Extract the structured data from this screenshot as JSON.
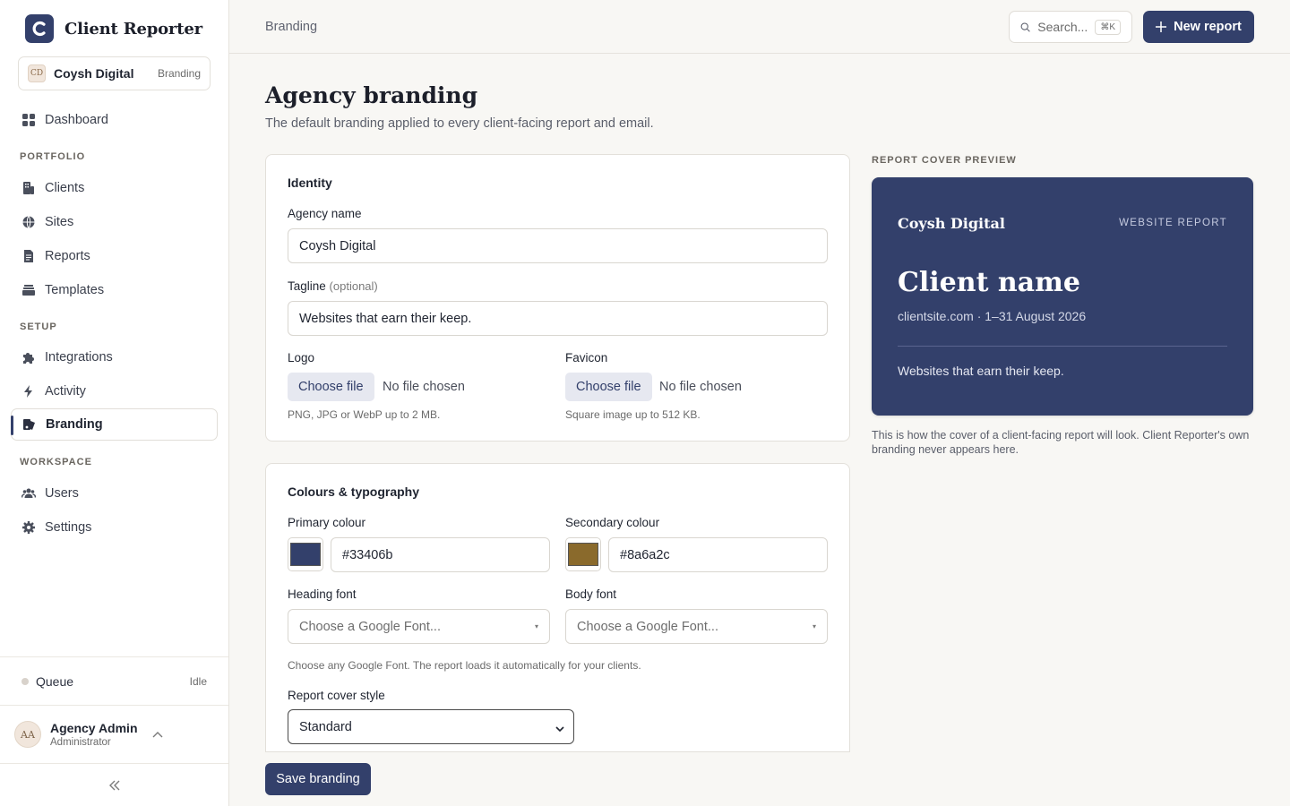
{
  "app": {
    "name": "Client Reporter",
    "brand_color": "#33406b",
    "org": {
      "initials": "CD",
      "name": "Coysh Digital",
      "tag": "Branding"
    }
  },
  "sidebar": {
    "dashboard": "Dashboard",
    "sections": {
      "portfolio": "PORTFOLIO",
      "setup": "SETUP",
      "workspace": "WORKSPACE"
    },
    "items": {
      "clients": "Clients",
      "sites": "Sites",
      "reports": "Reports",
      "templates": "Templates",
      "integrations": "Integrations",
      "activity": "Activity",
      "branding": "Branding",
      "users": "Users",
      "settings": "Settings"
    },
    "queue": {
      "label": "Queue",
      "status": "Idle"
    },
    "user": {
      "initials": "AA",
      "name": "Agency Admin",
      "role": "Administrator"
    }
  },
  "header": {
    "breadcrumb": "Branding",
    "search_placeholder": "Search...",
    "search_shortcut": "⌘K",
    "new_report": "New report"
  },
  "page": {
    "title": "Agency branding",
    "subtitle": "The default branding applied to every client-facing report and email."
  },
  "identity": {
    "title": "Identity",
    "agency_name_label": "Agency name",
    "agency_name_value": "Coysh Digital",
    "tagline_label": "Tagline",
    "tagline_optional": "(optional)",
    "tagline_value": "Websites that earn their keep.",
    "logo_label": "Logo",
    "logo_button": "Choose file",
    "logo_status": "No file chosen",
    "logo_hint": "PNG, JPG or WebP up to 2 MB.",
    "favicon_label": "Favicon",
    "favicon_button": "Choose file",
    "favicon_status": "No file chosen",
    "favicon_hint": "Square image up to 512 KB."
  },
  "colours": {
    "title": "Colours & typography",
    "primary_label": "Primary colour",
    "primary_value": "#33406b",
    "secondary_label": "Secondary colour",
    "secondary_value": "#8a6a2c",
    "heading_font_label": "Heading font",
    "heading_font_placeholder": "Choose a Google Font...",
    "body_font_label": "Body font",
    "body_font_placeholder": "Choose a Google Font...",
    "font_hint": "Choose any Google Font. The report loads it automatically for your clients.",
    "cover_style_label": "Report cover style",
    "cover_style_value": "Standard"
  },
  "actions": {
    "save": "Save branding"
  },
  "preview": {
    "label": "REPORT COVER PREVIEW",
    "agency": "Coysh Digital",
    "kind": "WEBSITE REPORT",
    "client": "Client name",
    "meta": "clientsite.com · 1–31 August 2026",
    "tagline": "Websites that earn their keep.",
    "note": "This is how the cover of a client-facing report will look. Client Reporter's own branding never appears here."
  }
}
